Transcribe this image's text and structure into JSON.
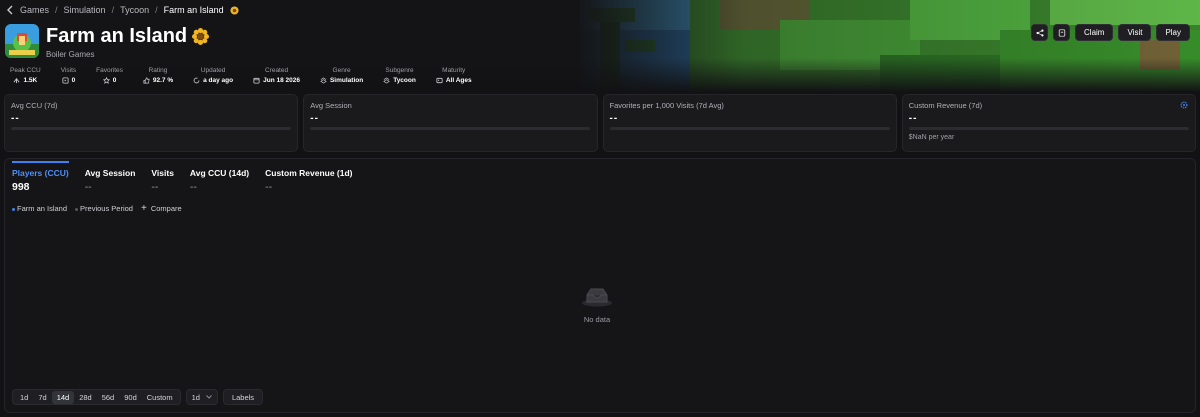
{
  "breadcrumb": {
    "items": [
      "Games",
      "Simulation",
      "Tycoon"
    ],
    "current": "Farm an Island"
  },
  "game": {
    "title": "Farm an Island",
    "developer": "Boiler Games"
  },
  "actions": {
    "share_icon": "share-icon",
    "bookmark_icon": "bookmark-icon",
    "claim_label": "Claim",
    "visit_label": "Visit",
    "play_label": "Play"
  },
  "stats": [
    {
      "label": "Peak CCU",
      "value": "1.5K",
      "icon": "peak-icon"
    },
    {
      "label": "Visits",
      "value": "0",
      "icon": "visits-icon"
    },
    {
      "label": "Favorites",
      "value": "0",
      "icon": "star-icon"
    },
    {
      "label": "Rating",
      "value": "92.7 %",
      "icon": "thumbs-up-icon"
    },
    {
      "label": "Updated",
      "value": "a day ago",
      "icon": "refresh-icon"
    },
    {
      "label": "Created",
      "value": "Jun 18 2026",
      "icon": "calendar-icon"
    },
    {
      "label": "Genre",
      "value": "Simulation",
      "icon": "genre-icon"
    },
    {
      "label": "Subgenre",
      "value": "Tycoon",
      "icon": "subgenre-icon"
    },
    {
      "label": "Maturity",
      "value": "All Ages",
      "icon": "maturity-icon"
    }
  ],
  "cards": [
    {
      "title": "Avg CCU (7d)",
      "value": "--"
    },
    {
      "title": "Avg Session",
      "value": "--"
    },
    {
      "title": "Favorites per 1,000 Visits (7d Avg)",
      "value": "--"
    },
    {
      "title": "Custom Revenue (7d)",
      "value": "--",
      "note": "$NaN per year"
    }
  ],
  "tabs": [
    {
      "label": "Players (CCU)",
      "value": "998"
    },
    {
      "label": "Avg Session",
      "value": "--"
    },
    {
      "label": "Visits",
      "value": "--"
    },
    {
      "label": "Avg CCU (14d)",
      "value": "--"
    },
    {
      "label": "Custom Revenue (1d)",
      "value": "--"
    }
  ],
  "legend": {
    "series": "Farm an Island",
    "previous": "Previous Period",
    "compare": "Compare"
  },
  "chart": {
    "empty_label": "No data"
  },
  "ranges": [
    "1d",
    "7d",
    "14d",
    "28d",
    "56d",
    "90d",
    "Custom"
  ],
  "active_range": "14d",
  "interval": "1d",
  "labels_button": "Labels",
  "colors": {
    "accent": "#3b82f6",
    "background": "#121214",
    "card": "#1a1a1d"
  }
}
